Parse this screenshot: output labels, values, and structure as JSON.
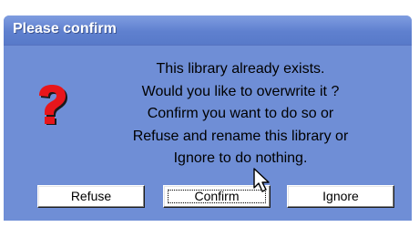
{
  "dialog": {
    "title": "Please confirm",
    "icon": "question-mark-icon",
    "message_lines": [
      "This library already exists.",
      "Would you like to overwrite it ?",
      "Confirm you want to do so or",
      "Refuse and rename this library or",
      "Ignore to do nothing."
    ],
    "buttons": {
      "refuse": "Refuse",
      "confirm": "Confirm",
      "ignore": "Ignore"
    },
    "focused_button": "confirm",
    "colors": {
      "title_bar": "#5f80cf",
      "body": "#6f8ed6",
      "icon_red": "#e8161b"
    }
  }
}
